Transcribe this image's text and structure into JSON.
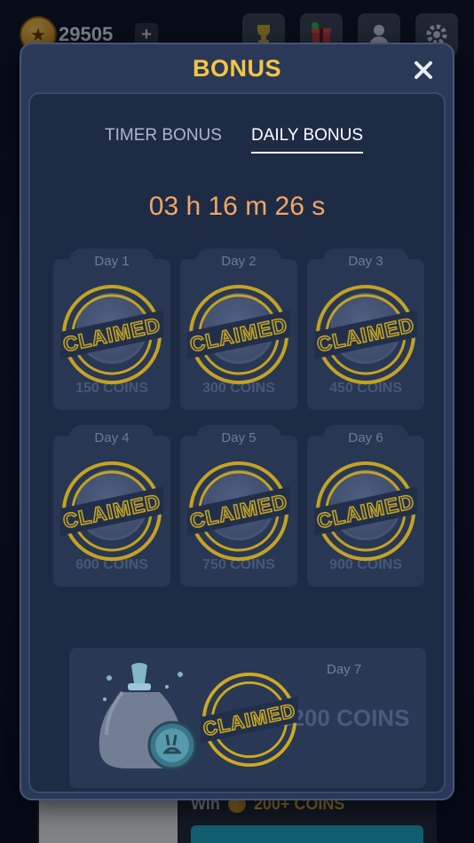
{
  "topbar": {
    "coins": "29505",
    "plus_label": "+"
  },
  "modal": {
    "title": "BONUS",
    "close_label": "✕",
    "tabs": [
      {
        "label": "TIMER BONUS",
        "active": false
      },
      {
        "label": "DAILY BONUS",
        "active": true
      }
    ],
    "countdown": "03 h 16 m 26 s",
    "stamp_text": "CLAIMED",
    "days": [
      {
        "label": "Day 1",
        "amount": "150 COINS",
        "claimed": true
      },
      {
        "label": "Day 2",
        "amount": "300 COINS",
        "claimed": true
      },
      {
        "label": "Day 3",
        "amount": "450 COINS",
        "claimed": true
      },
      {
        "label": "Day 4",
        "amount": "600 COINS",
        "claimed": true
      },
      {
        "label": "Day 5",
        "amount": "750 COINS",
        "claimed": true
      },
      {
        "label": "Day 6",
        "amount": "900 COINS",
        "claimed": true
      }
    ],
    "day7": {
      "label": "Day 7",
      "amount": "1200 COINS",
      "claimed": true
    }
  },
  "background": {
    "win_label": "Win",
    "win_amount": "200+ COINS"
  },
  "colors": {
    "title_gold": "#f6c544",
    "countdown_orange": "#f4a566",
    "stamp_yellow": "#e2b71f",
    "panel": "#1e2b45"
  }
}
